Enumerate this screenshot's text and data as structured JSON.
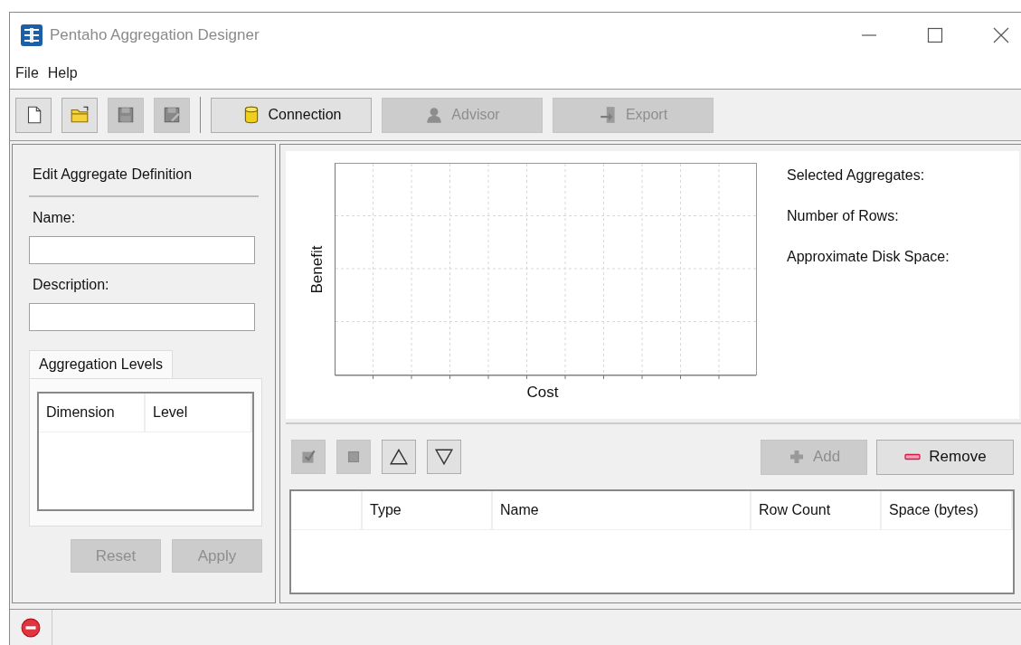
{
  "window": {
    "title": "Pentaho Aggregation Designer"
  },
  "menu": [
    "File",
    "Help"
  ],
  "toolbar": [
    {
      "disabled": false
    },
    {
      "disabled": false
    },
    {
      "disabled": true
    },
    {
      "disabled": true
    },
    {
      "label": "Connection",
      "disabled": false
    },
    {
      "label": "Advisor",
      "disabled": true
    },
    {
      "label": "Export",
      "disabled": true
    }
  ],
  "definition": {
    "heading": "Edit Aggregate Definition",
    "name_label": "Name:",
    "description_label": "Description:",
    "tabs": [
      {
        "label": "Aggregation Levels",
        "selected": true
      }
    ],
    "columns": [
      "Dimension",
      "Level"
    ],
    "buttons": [
      {
        "label": "Reset",
        "disabled": true
      },
      {
        "label": "Apply",
        "disabled": true
      }
    ]
  },
  "chart": {
    "xlabel": "Cost",
    "ylabel": "Benefit"
  },
  "summary": [
    "Selected Aggregates:",
    "Number of Rows:",
    "Approximate Disk Space:"
  ],
  "aggregate_tools": [
    {
      "disabled": true
    },
    {
      "disabled": true
    },
    {
      "disabled": false
    },
    {
      "disabled": false
    }
  ],
  "aggregate_buttons": [
    {
      "label": "Add",
      "disabled": true
    },
    {
      "label": "Remove",
      "disabled": false
    }
  ],
  "aggregates": {
    "columns": [
      "Type",
      "Name",
      "Row Count",
      "Space (bytes)"
    ]
  }
}
